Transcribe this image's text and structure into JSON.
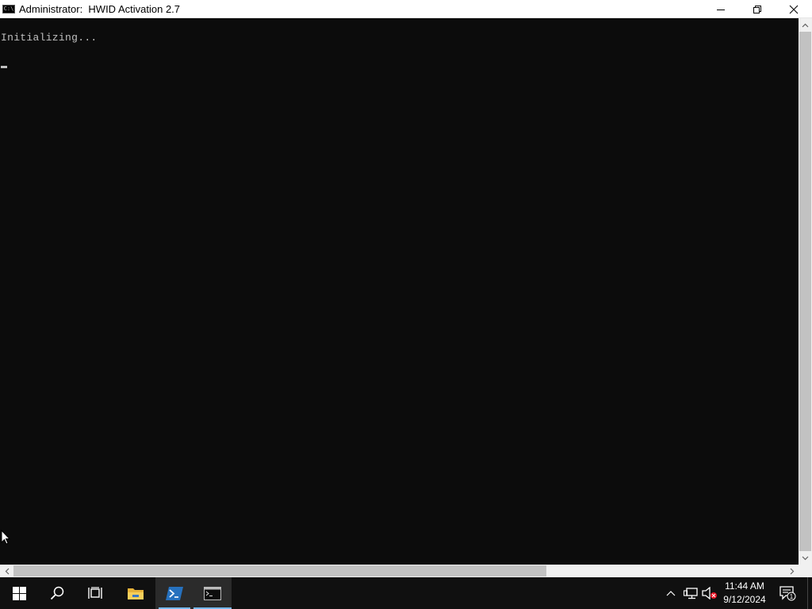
{
  "window": {
    "icon_text": "C:\\",
    "title": "Administrator:  HWID Activation 2.7",
    "buttons": {
      "minimize": "minimize-icon",
      "restore": "restore-icon",
      "close": "close-icon"
    }
  },
  "console": {
    "lines": [
      "Initializing..."
    ],
    "background": "#0c0c0c",
    "foreground": "#c0c0c0"
  },
  "taskbar": {
    "items": [
      {
        "name": "start",
        "icon": "windows-logo-icon"
      },
      {
        "name": "search",
        "icon": "search-icon"
      },
      {
        "name": "task-view",
        "icon": "task-view-icon"
      },
      {
        "name": "file-explorer",
        "icon": "folder-icon"
      },
      {
        "name": "powershell",
        "icon": "powershell-icon"
      },
      {
        "name": "command-prompt",
        "icon": "command-prompt-icon"
      }
    ],
    "accent": "#76b9ed",
    "tray": {
      "icons": [
        "chevron-up-icon",
        "network-icon",
        "volume-muted-icon"
      ],
      "time": "11:44 AM",
      "date": "9/12/2024",
      "notification_count": "1"
    }
  }
}
